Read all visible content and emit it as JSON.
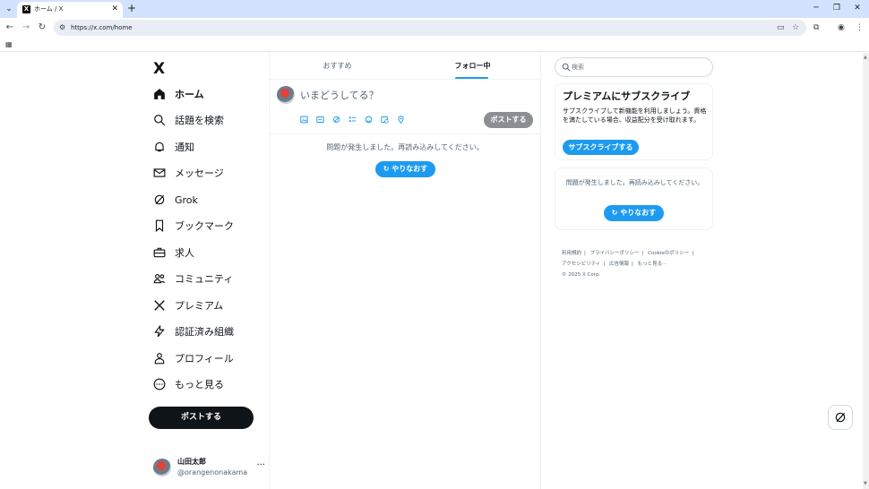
{
  "browser": {
    "tab_title": "ホーム / X",
    "favicon_text": "X",
    "url": "https://x.com/home",
    "window_min": "─",
    "window_max": "❐",
    "window_close": "✕",
    "new_tab": "+",
    "tab_close": "✕"
  },
  "sidebar": {
    "logo": "X",
    "items": [
      {
        "label": "ホーム",
        "icon": "home-icon"
      },
      {
        "label": "話題を検索",
        "icon": "search-icon"
      },
      {
        "label": "通知",
        "icon": "bell-icon"
      },
      {
        "label": "メッセージ",
        "icon": "mail-icon"
      },
      {
        "label": "Grok",
        "icon": "grok-icon"
      },
      {
        "label": "ブックマーク",
        "icon": "bookmark-icon"
      },
      {
        "label": "求人",
        "icon": "briefcase-icon"
      },
      {
        "label": "コミュニティ",
        "icon": "people-icon"
      },
      {
        "label": "プレミアム",
        "icon": "x-icon"
      },
      {
        "label": "認証済み組織",
        "icon": "lightning-icon"
      },
      {
        "label": "プロフィール",
        "icon": "person-icon"
      },
      {
        "label": "もっと見る",
        "icon": "more-circle-icon"
      }
    ],
    "post_button": "ポストする",
    "account": {
      "name": "山田太郎",
      "handle": "@orangenonakama",
      "more": "···"
    }
  },
  "main": {
    "tabs": [
      {
        "label": "おすすめ"
      },
      {
        "label": "フォロー中"
      }
    ],
    "compose_placeholder": "いまどうしてる？",
    "post_button": "ポストする",
    "error_message": "問題が発生しました。再読み込みしてください。",
    "retry_button": "やりなおす"
  },
  "right": {
    "search_placeholder": "検索",
    "premium": {
      "title": "プレミアムにサブスクライブ",
      "description": "サブスクライブして新機能を利用しましょう。資格を満たしている場合、収益配分を受け取れます。",
      "button": "サブスクライブする"
    },
    "error_card": {
      "message": "問題が発生しました。再読み込みしてください。",
      "retry_button": "やりなおす"
    },
    "footer": {
      "links": [
        "利用規約",
        "プライバシーポリシー",
        "Cookieのポリシー",
        "アクセシビリティ",
        "広告情報",
        "もっと見る···"
      ],
      "copyright": "© 2025 X Corp."
    }
  },
  "colors": {
    "accent": "#1d9bf0",
    "text": "#0f1419",
    "muted": "#536471",
    "chrome": "#d3e3fd"
  }
}
